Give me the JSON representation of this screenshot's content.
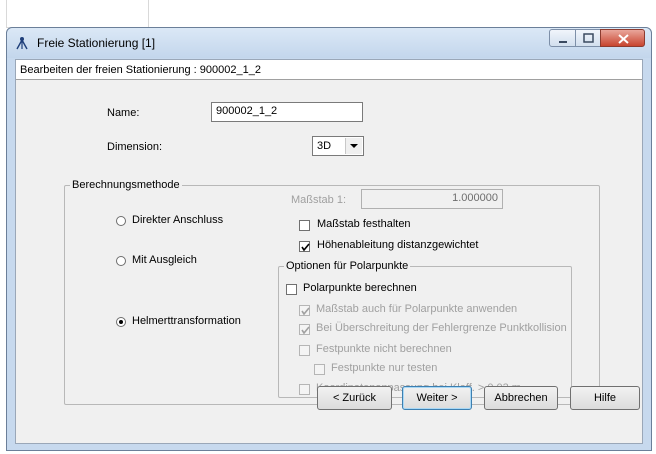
{
  "window": {
    "title": "Freie Stationierung [1]",
    "header": "Bearbeiten der freien Stationierung : 900002_1_2"
  },
  "form": {
    "name_label": "Name:",
    "name_value": "900002_1_2",
    "dimension_label": "Dimension:",
    "dimension_value": "3D"
  },
  "method": {
    "group_title": "Berechnungsmethode",
    "options": [
      {
        "label": "Direkter Anschluss",
        "selected": false
      },
      {
        "label": "Mit Ausgleich",
        "selected": false
      },
      {
        "label": "Helmerttransformation",
        "selected": true
      }
    ],
    "scale_label": "Maßstab 1:",
    "scale_value": "1.000000",
    "fix_scale_label": "Maßstab festhalten",
    "fix_scale_checked": false,
    "height_label": "Höhenableitung distanzgewichtet",
    "height_checked": true
  },
  "polar": {
    "group_title": "Optionen für Polarpunkte",
    "items": [
      {
        "label": "Polarpunkte berechnen",
        "checked": false,
        "enabled": true
      },
      {
        "label": "Maßstab auch für Polarpunkte anwenden",
        "checked": true,
        "enabled": false
      },
      {
        "label": "Bei Überschreitung der Fehlergrenze Punktkollision",
        "checked": true,
        "enabled": false
      },
      {
        "label": "Festpunkte nicht berechnen",
        "checked": false,
        "enabled": false
      },
      {
        "label": "Festpunkte nur testen",
        "checked": false,
        "enabled": false
      },
      {
        "label": "Koordinatenanpassung bei Klaff. > 0.03 m",
        "checked": false,
        "enabled": false
      }
    ]
  },
  "buttons": {
    "back": "< Zurück",
    "next": "Weiter >",
    "cancel": "Abbrechen",
    "help": "Hilfe"
  },
  "icons": {
    "title": "tripod-icon",
    "minimize": "minimize-icon",
    "maximize": "maximize-icon",
    "close": "close-icon",
    "dropdown": "chevron-down-icon"
  },
  "colors": {
    "title_bar": "#c3d6ec",
    "close_button": "#c8452f",
    "dialog_bg": "#f0f0f0",
    "default_button_border": "#3c7fb1"
  }
}
